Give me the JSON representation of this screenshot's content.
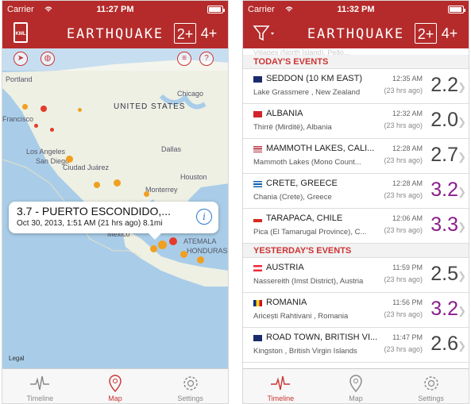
{
  "left": {
    "status": {
      "carrier": "Carrier",
      "time": "11:27 PM"
    },
    "nav": {
      "title": "EARTHQUAKE",
      "mag_a": "2+",
      "mag_b": "4+",
      "kml": "KML"
    },
    "map_labels": {
      "united_states": "UNITED STATES",
      "chicago": "Chicago",
      "portland": "Portland",
      "francisco": "Francisco",
      "los_angeles": "Los Angeles",
      "san_diego": "San Diego",
      "ciudad_juarez": "Ciudad Juárez",
      "dallas": "Dallas",
      "houston": "Houston",
      "monterrey": "Monterrey",
      "mexico": "Mexico",
      "guatemala": "ATEMALA",
      "honduras": "HONDURAS",
      "legal": "Legal"
    },
    "callout": {
      "title": "3.7 - PUERTO ESCONDIDO,...",
      "subtitle": "Oct 30, 2013, 1:51 AM (21 hrs ago) 8.1mi",
      "info_icon": "i"
    },
    "tabs": [
      {
        "label": "Timeline",
        "icon": "pulse-icon"
      },
      {
        "label": "Map",
        "icon": "map-pin-icon"
      },
      {
        "label": "Settings",
        "icon": "gear-icon"
      }
    ]
  },
  "right": {
    "status": {
      "carrier": "Carrier",
      "time": "11:32 PM"
    },
    "nav": {
      "title": "EARTHQUAKE",
      "mag_a": "2+",
      "mag_b": "4+"
    },
    "ghost_row": "Villages (North Island), Pelto...",
    "sections": [
      {
        "title": "TODAY'S EVENTS",
        "rows": [
          {
            "place": "SEDDON (10 KM EAST)",
            "region": "Lake Grassmere , New Zealand",
            "time": "12:35 AM",
            "ago": "(23 hrs ago)",
            "mag": "2.2",
            "flag": "nz"
          },
          {
            "place": "ALBANIA",
            "region": "Thirrë (Mirditë), Albania",
            "time": "12:32 AM",
            "ago": "(23 hrs ago)",
            "mag": "2.0",
            "flag": "al"
          },
          {
            "place": "MAMMOTH LAKES, CALI...",
            "region": "Mammoth Lakes (Mono Count...",
            "time": "12:28 AM",
            "ago": "(23 hrs ago)",
            "mag": "2.7",
            "flag": "us"
          },
          {
            "place": "CRETE, GREECE",
            "region": "Chania (Crete), Greece",
            "time": "12:28 AM",
            "ago": "(23 hrs ago)",
            "mag": "3.2",
            "flag": "gr"
          },
          {
            "place": "TARAPACA, CHILE",
            "region": "Pica (El Tamarugal Province), C...",
            "time": "12:06 AM",
            "ago": "(23 hrs ago)",
            "mag": "3.3",
            "flag": "cl"
          }
        ]
      },
      {
        "title": "YESTERDAY'S EVENTS",
        "rows": [
          {
            "place": "AUSTRIA",
            "region": "Nassereith (Imst District), Austria",
            "time": "11:59 PM",
            "ago": "(23 hrs ago)",
            "mag": "2.5",
            "flag": "at"
          },
          {
            "place": "ROMANIA",
            "region": "Aricești Rahtivani , Romania",
            "time": "11:56 PM",
            "ago": "(23 hrs ago)",
            "mag": "3.2",
            "flag": "ro"
          },
          {
            "place": "ROAD TOWN, BRITISH VI...",
            "region": "Kingston , British Virgin Islands",
            "time": "11:47 PM",
            "ago": "(23 hrs ago)",
            "mag": "2.6",
            "flag": "vg"
          }
        ]
      }
    ],
    "tabs": [
      {
        "label": "Timeline",
        "icon": "pulse-icon"
      },
      {
        "label": "Map",
        "icon": "map-pin-icon"
      },
      {
        "label": "Settings",
        "icon": "gear-icon"
      }
    ]
  },
  "colors": {
    "brand": "#b52b2b",
    "purple_mag": "#8a1f8c",
    "gray_mag": "#444444"
  }
}
